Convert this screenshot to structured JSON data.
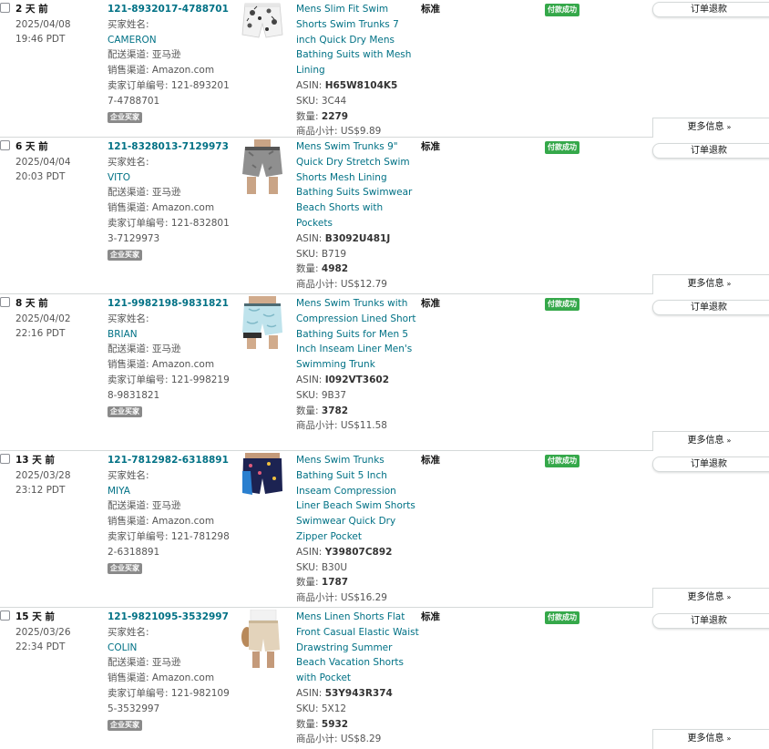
{
  "labels": {
    "buyer_name": "买家姓名:",
    "fulfillment": "配送渠道: ",
    "sales_channel": "销售渠道: ",
    "seller_order_id": "卖家订单编号: ",
    "business_buyer": "企业买家",
    "asin": "ASIN: ",
    "sku": "SKU: ",
    "quantity": "数量: ",
    "subtotal": "商品小计: ",
    "shipping_service": "标准",
    "payment_status": "付款成功",
    "refund_button": "订单退款",
    "more_info": "更多信息",
    "chevron": "»"
  },
  "orders": [
    {
      "age": "2 天 前",
      "date": "2025/04/08",
      "time": "19:46 PDT",
      "order_id": "121-8932017-4788701",
      "buyer": "CAMERON",
      "fulfillment": "亚马逊",
      "channel": "Amazon.com",
      "seller_order_id": "121-8932017-4788701",
      "title": "Mens Slim Fit Swim Shorts Swim Trunks 7 inch Quick Dry Mens Bathing Suits with Mesh Lining",
      "asin": "H65W8104K5",
      "sku": "3C44",
      "qty": "2279",
      "subtotal": "US$9.89"
    },
    {
      "age": "6 天 前",
      "date": "2025/04/04",
      "time": "20:03 PDT",
      "order_id": "121-8328013-7129973",
      "buyer": "VITO",
      "fulfillment": "亚马逊",
      "channel": "Amazon.com",
      "seller_order_id": "121-8328013-7129973",
      "title": "Mens Swim Trunks 9\" Quick Dry Stretch Swim Shorts Mesh Lining Bathing Suits Swimwear Beach Shorts with Pockets",
      "asin": "B3092U481J",
      "sku": "B719",
      "qty": "4982",
      "subtotal": "US$12.79"
    },
    {
      "age": "8 天 前",
      "date": "2025/04/02",
      "time": "22:16 PDT",
      "order_id": "121-9982198-9831821",
      "buyer": "BRIAN",
      "fulfillment": "亚马逊",
      "channel": "Amazon.com",
      "seller_order_id": "121-9982198-9831821",
      "title": "Mens Swim Trunks with Compression Lined Short Bathing Suits for Men 5 Inch Inseam Liner Men's Swimming Trunk",
      "asin": "I092VT3602",
      "sku": "9B37",
      "qty": "3782",
      "subtotal": "US$11.58"
    },
    {
      "age": "13 天 前",
      "date": "2025/03/28",
      "time": "23:12 PDT",
      "order_id": "121-7812982-6318891",
      "buyer": "MIYA",
      "fulfillment": "亚马逊",
      "channel": "Amazon.com",
      "seller_order_id": "121-7812982-6318891",
      "title": "Mens Swim Trunks Bathing Suit 5 Inch Inseam Compression Liner Beach Swim Shorts Swimwear Quick Dry Zipper Pocket",
      "asin": "Y39807C892",
      "sku": "B30U",
      "qty": "1787",
      "subtotal": "US$16.29"
    },
    {
      "age": "15 天 前",
      "date": "2025/03/26",
      "time": "22:34 PDT",
      "order_id": "121-9821095-3532997",
      "buyer": "COLIN",
      "fulfillment": "亚马逊",
      "channel": "Amazon.com",
      "seller_order_id": "121-9821095-3532997",
      "title": "Mens Linen Shorts Flat Front Casual Elastic Waist Drawstring Summer Beach Vacation Shorts with Pocket",
      "asin": "53Y943R374",
      "sku": "5X12",
      "qty": "5932",
      "subtotal": "US$8.29"
    }
  ],
  "colors": {
    "link": "#007185",
    "status_green": "#35a84a",
    "badge_gray": "#8a8a8a",
    "border": "#d5d9d9"
  }
}
